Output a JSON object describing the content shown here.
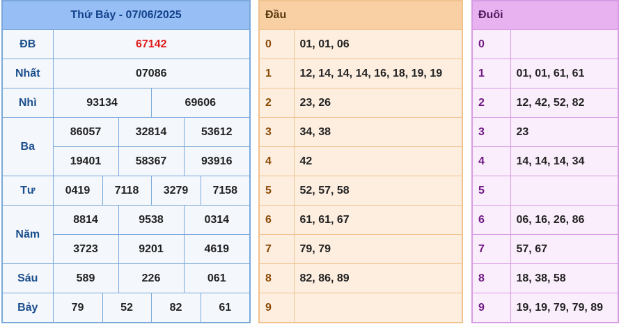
{
  "results": {
    "header": "Thứ Bảy - 07/06/2025",
    "rows": {
      "db": {
        "label": "ĐB",
        "values": [
          "67142"
        ]
      },
      "nhat": {
        "label": "Nhất",
        "values": [
          "07086"
        ]
      },
      "nhi": {
        "label": "Nhì",
        "values": [
          "93134",
          "69606"
        ]
      },
      "ba": {
        "label": "Ba",
        "values": [
          "86057",
          "32814",
          "53612",
          "19401",
          "58367",
          "93916"
        ]
      },
      "tu": {
        "label": "Tư",
        "values": [
          "0419",
          "7118",
          "3279",
          "7158"
        ]
      },
      "nam": {
        "label": "Năm",
        "values": [
          "8814",
          "9538",
          "0314",
          "3723",
          "9201",
          "4619"
        ]
      },
      "sau": {
        "label": "Sáu",
        "values": [
          "589",
          "226",
          "061"
        ]
      },
      "bay": {
        "label": "Bảy",
        "values": [
          "79",
          "52",
          "82",
          "61"
        ]
      }
    }
  },
  "dau": {
    "header": "Đầu",
    "rows": [
      {
        "digit": "0",
        "list": "01, 01, 06"
      },
      {
        "digit": "1",
        "list": "12, 14, 14, 14, 16, 18, 19, 19"
      },
      {
        "digit": "2",
        "list": "23, 26"
      },
      {
        "digit": "3",
        "list": "34, 38"
      },
      {
        "digit": "4",
        "list": "42"
      },
      {
        "digit": "5",
        "list": "52, 57, 58"
      },
      {
        "digit": "6",
        "list": "61, 61, 67"
      },
      {
        "digit": "7",
        "list": "79, 79"
      },
      {
        "digit": "8",
        "list": "82, 86, 89"
      },
      {
        "digit": "9",
        "list": ""
      }
    ]
  },
  "duoi": {
    "header": "Đuôi",
    "rows": [
      {
        "digit": "0",
        "list": ""
      },
      {
        "digit": "1",
        "list": "01, 01, 61, 61"
      },
      {
        "digit": "2",
        "list": "12, 42, 52, 82"
      },
      {
        "digit": "3",
        "list": "23"
      },
      {
        "digit": "4",
        "list": "14, 14, 14, 34"
      },
      {
        "digit": "5",
        "list": ""
      },
      {
        "digit": "6",
        "list": "06, 16, 26, 86"
      },
      {
        "digit": "7",
        "list": "57, 67"
      },
      {
        "digit": "8",
        "list": "18, 38, 58"
      },
      {
        "digit": "9",
        "list": "19, 19, 79, 79, 89"
      }
    ]
  },
  "colors": {
    "results_header_bg": "#97bff5",
    "results_border": "#7aa8da",
    "special_prize": "#e01b1b",
    "dau_header_bg": "#f9cfa4",
    "dau_cell_bg": "#fdeee0",
    "duoi_header_bg": "#e7b2ef",
    "duoi_cell_bg": "#fbeefc"
  }
}
